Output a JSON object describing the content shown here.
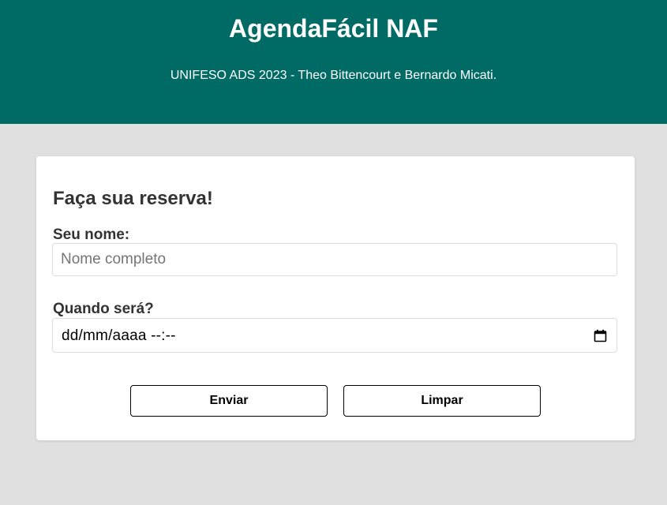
{
  "header": {
    "title": "AgendaFácil NAF",
    "subtitle": "UNIFESO ADS 2023 - Theo Bittencourt e Bernardo Micati."
  },
  "form": {
    "heading": "Faça sua reserva!",
    "name_label": "Seu nome:",
    "name_placeholder": "Nome completo",
    "name_value": "",
    "date_label": "Quando será?",
    "date_value": "dd/mm/aaaa --:--",
    "submit_label": "Enviar",
    "reset_label": "Limpar"
  },
  "icons": {
    "date_picker": "calendar-icon"
  },
  "colors": {
    "header_bg": "#006b65",
    "page_bg": "#e0e0e0",
    "card_bg": "#ffffff"
  }
}
